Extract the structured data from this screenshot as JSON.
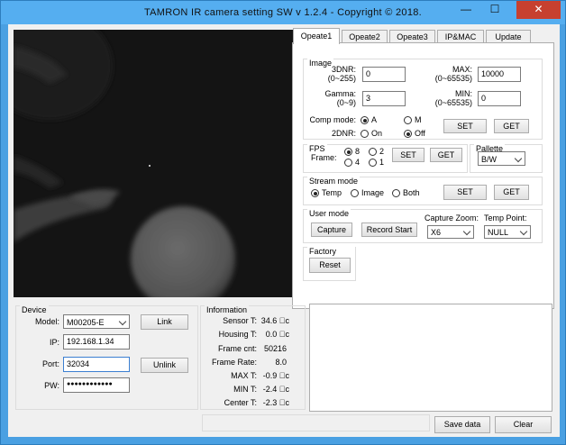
{
  "window": {
    "title": "TAMRON IR camera setting SW v 1.2.4        - Copyright ©  2018."
  },
  "titlebar_buttons": {
    "minimize": "—",
    "maximize": "☐",
    "close": "✕"
  },
  "tabs": [
    "Opeate1",
    "Opeate2",
    "Opeate3",
    "IP&MAC",
    "Update"
  ],
  "image": {
    "label": "Image",
    "dnr3d_label_line1": "3DNR:",
    "dnr3d_label_line2": "(0~255)",
    "dnr3d_value": "0",
    "max_label_line1": "MAX:",
    "max_label_line2": "(0~65535)",
    "max_value": "10000",
    "gamma_label_line1": "Gamma:",
    "gamma_label_line2": "(0~9)",
    "gamma_value": "3",
    "min_label_line1": "MIN:",
    "min_label_line2": "(0~65535)",
    "min_value": "0",
    "comp_mode_label": "Comp mode:",
    "comp_a": "A",
    "comp_m": "M",
    "dnr2d_label": "2DNR:",
    "dnr2d_on": "On",
    "dnr2d_off": "Off",
    "set": "SET",
    "get": "GET"
  },
  "fps": {
    "label": "FPS",
    "frame_label": "Frame:",
    "opt8": "8",
    "opt2": "2",
    "opt4": "4",
    "opt1": "1",
    "set": "SET",
    "get": "GET"
  },
  "pallete": {
    "label": "Pallette",
    "value": "B/W"
  },
  "stream": {
    "label": "Stream mode",
    "temp": "Temp",
    "image": "Image",
    "both": "Both",
    "set": "SET",
    "get": "GET"
  },
  "user_mode": {
    "label": "User mode",
    "capture": "Capture",
    "record": "Record Start",
    "zoom_label": "Capture Zoom:",
    "zoom_value": "X6",
    "temp_point_label": "Temp Point:",
    "temp_point_value": "NULL"
  },
  "factory": {
    "label": "Factory reset",
    "reset": "Reset"
  },
  "device": {
    "label": "Device",
    "model_label": "Model:",
    "model_value": "M00205-E",
    "ip_label": "IP:",
    "ip_value": "192.168.1.34",
    "port_label": "Port:",
    "port_value": "32034",
    "pw_label": "PW:",
    "pw_value": "●●●●●●●●●●●●",
    "link": "Link",
    "unlink": "Unlink"
  },
  "information": {
    "label": "Information",
    "rows": [
      {
        "label": "Sensor T:",
        "value": "34.6 ゚c"
      },
      {
        "label": "Housing T:",
        "value": "0.0 ゚c"
      },
      {
        "label": "Frame cnt:",
        "value": "50216"
      },
      {
        "label": "Frame Rate:",
        "value": "8.0"
      },
      {
        "label": "MAX T:",
        "value": "-0.9 ゚c"
      },
      {
        "label": "MIN T:",
        "value": "-2.4 ゚c"
      },
      {
        "label": "Center T:",
        "value": "-2.3 ゚c"
      }
    ]
  },
  "bottom": {
    "save": "Save data",
    "clear": "Clear"
  }
}
